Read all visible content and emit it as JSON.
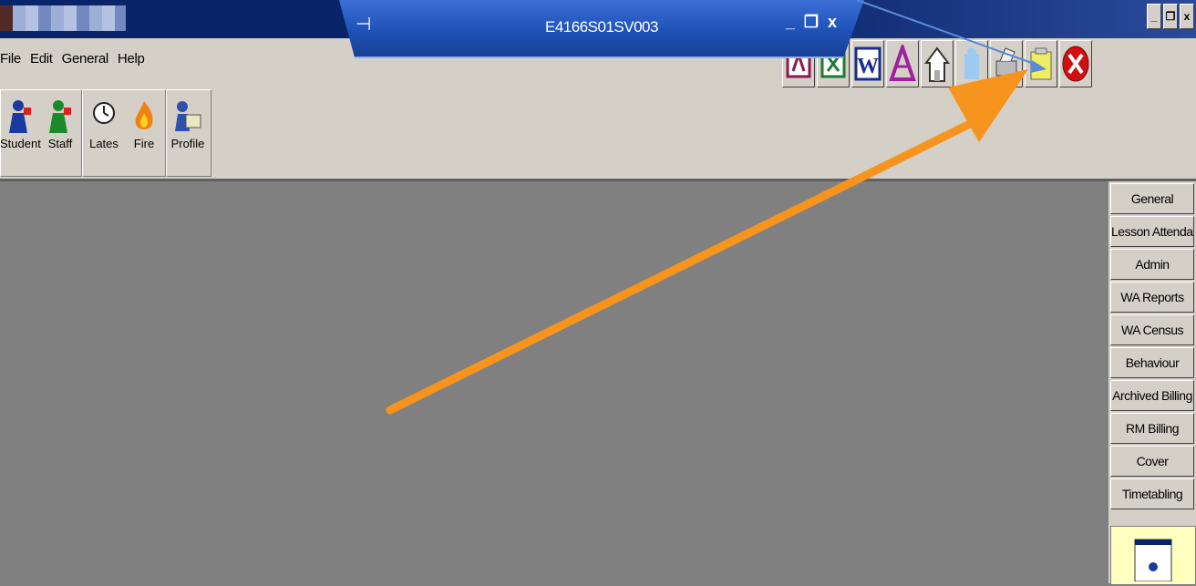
{
  "remote_bar": {
    "title": "E4166S01SV003"
  },
  "window_controls": {
    "minimize": "_",
    "restore": "❐",
    "close": "x"
  },
  "remote_controls": {
    "minimize": "_",
    "restore": "❐",
    "close": "x"
  },
  "menu": [
    "File",
    "Edit",
    "General",
    "Help"
  ],
  "toolbar": {
    "tools": [
      {
        "label": "Student",
        "icon": "student-icon"
      },
      {
        "label": "Staff",
        "icon": "staff-icon"
      },
      {
        "label": "Lates",
        "icon": "clock-icon"
      },
      {
        "label": "Fire",
        "icon": "fire-icon"
      },
      {
        "label": "Profile",
        "icon": "profile-icon"
      }
    ]
  },
  "app_icons": [
    {
      "label": "",
      "icon": "access-icon"
    },
    {
      "label": "",
      "icon": "excel-icon"
    },
    {
      "label": "W",
      "icon": "word-icon"
    },
    {
      "label": "",
      "icon": "publisher-icon"
    },
    {
      "label": "",
      "icon": "home-icon"
    },
    {
      "label": "",
      "icon": "puzzle-icon"
    },
    {
      "label": "",
      "icon": "printer-icon"
    },
    {
      "label": "",
      "icon": "folder-icon"
    },
    {
      "label": "",
      "icon": "close-red-icon"
    }
  ],
  "nav_buttons": [
    "General",
    "Lesson Attendance",
    "Admin",
    "WA Reports",
    "WA Census",
    "Behaviour",
    "Archived Billing",
    "RM Billing",
    "Cover",
    "Timetabling"
  ],
  "colors": {
    "title_bar": "#0a246a",
    "remote_bar": "#1f52b8",
    "arrow": "#f7941d",
    "background": "#808080",
    "face": "#d4d0c8"
  }
}
